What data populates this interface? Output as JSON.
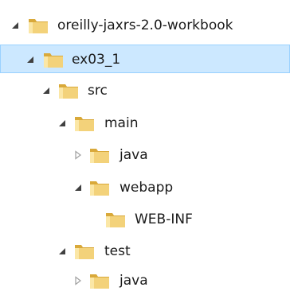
{
  "tree": {
    "nodes": [
      {
        "label": "oreilly-jaxrs-2.0-workbook",
        "state": "expanded",
        "selected": false
      },
      {
        "label": "ex03_1",
        "state": "expanded",
        "selected": true
      },
      {
        "label": "src",
        "state": "expanded",
        "selected": false
      },
      {
        "label": "main",
        "state": "expanded",
        "selected": false
      },
      {
        "label": "java",
        "state": "collapsed",
        "selected": false
      },
      {
        "label": "webapp",
        "state": "expanded",
        "selected": false
      },
      {
        "label": "WEB-INF",
        "state": "leaf",
        "selected": false
      },
      {
        "label": "test",
        "state": "expanded",
        "selected": false
      },
      {
        "label": "java",
        "state": "collapsed",
        "selected": false
      }
    ]
  },
  "colors": {
    "selection_fill": "#cce8ff",
    "selection_border": "#99d1ff",
    "folder": "#e8c15a",
    "expanded_arrow": "#404040",
    "collapsed_arrow": "#a0a0a0"
  },
  "icons": {
    "folder": "folder-icon",
    "expanded": "expanded-triangle-icon",
    "collapsed": "collapsed-triangle-icon"
  }
}
